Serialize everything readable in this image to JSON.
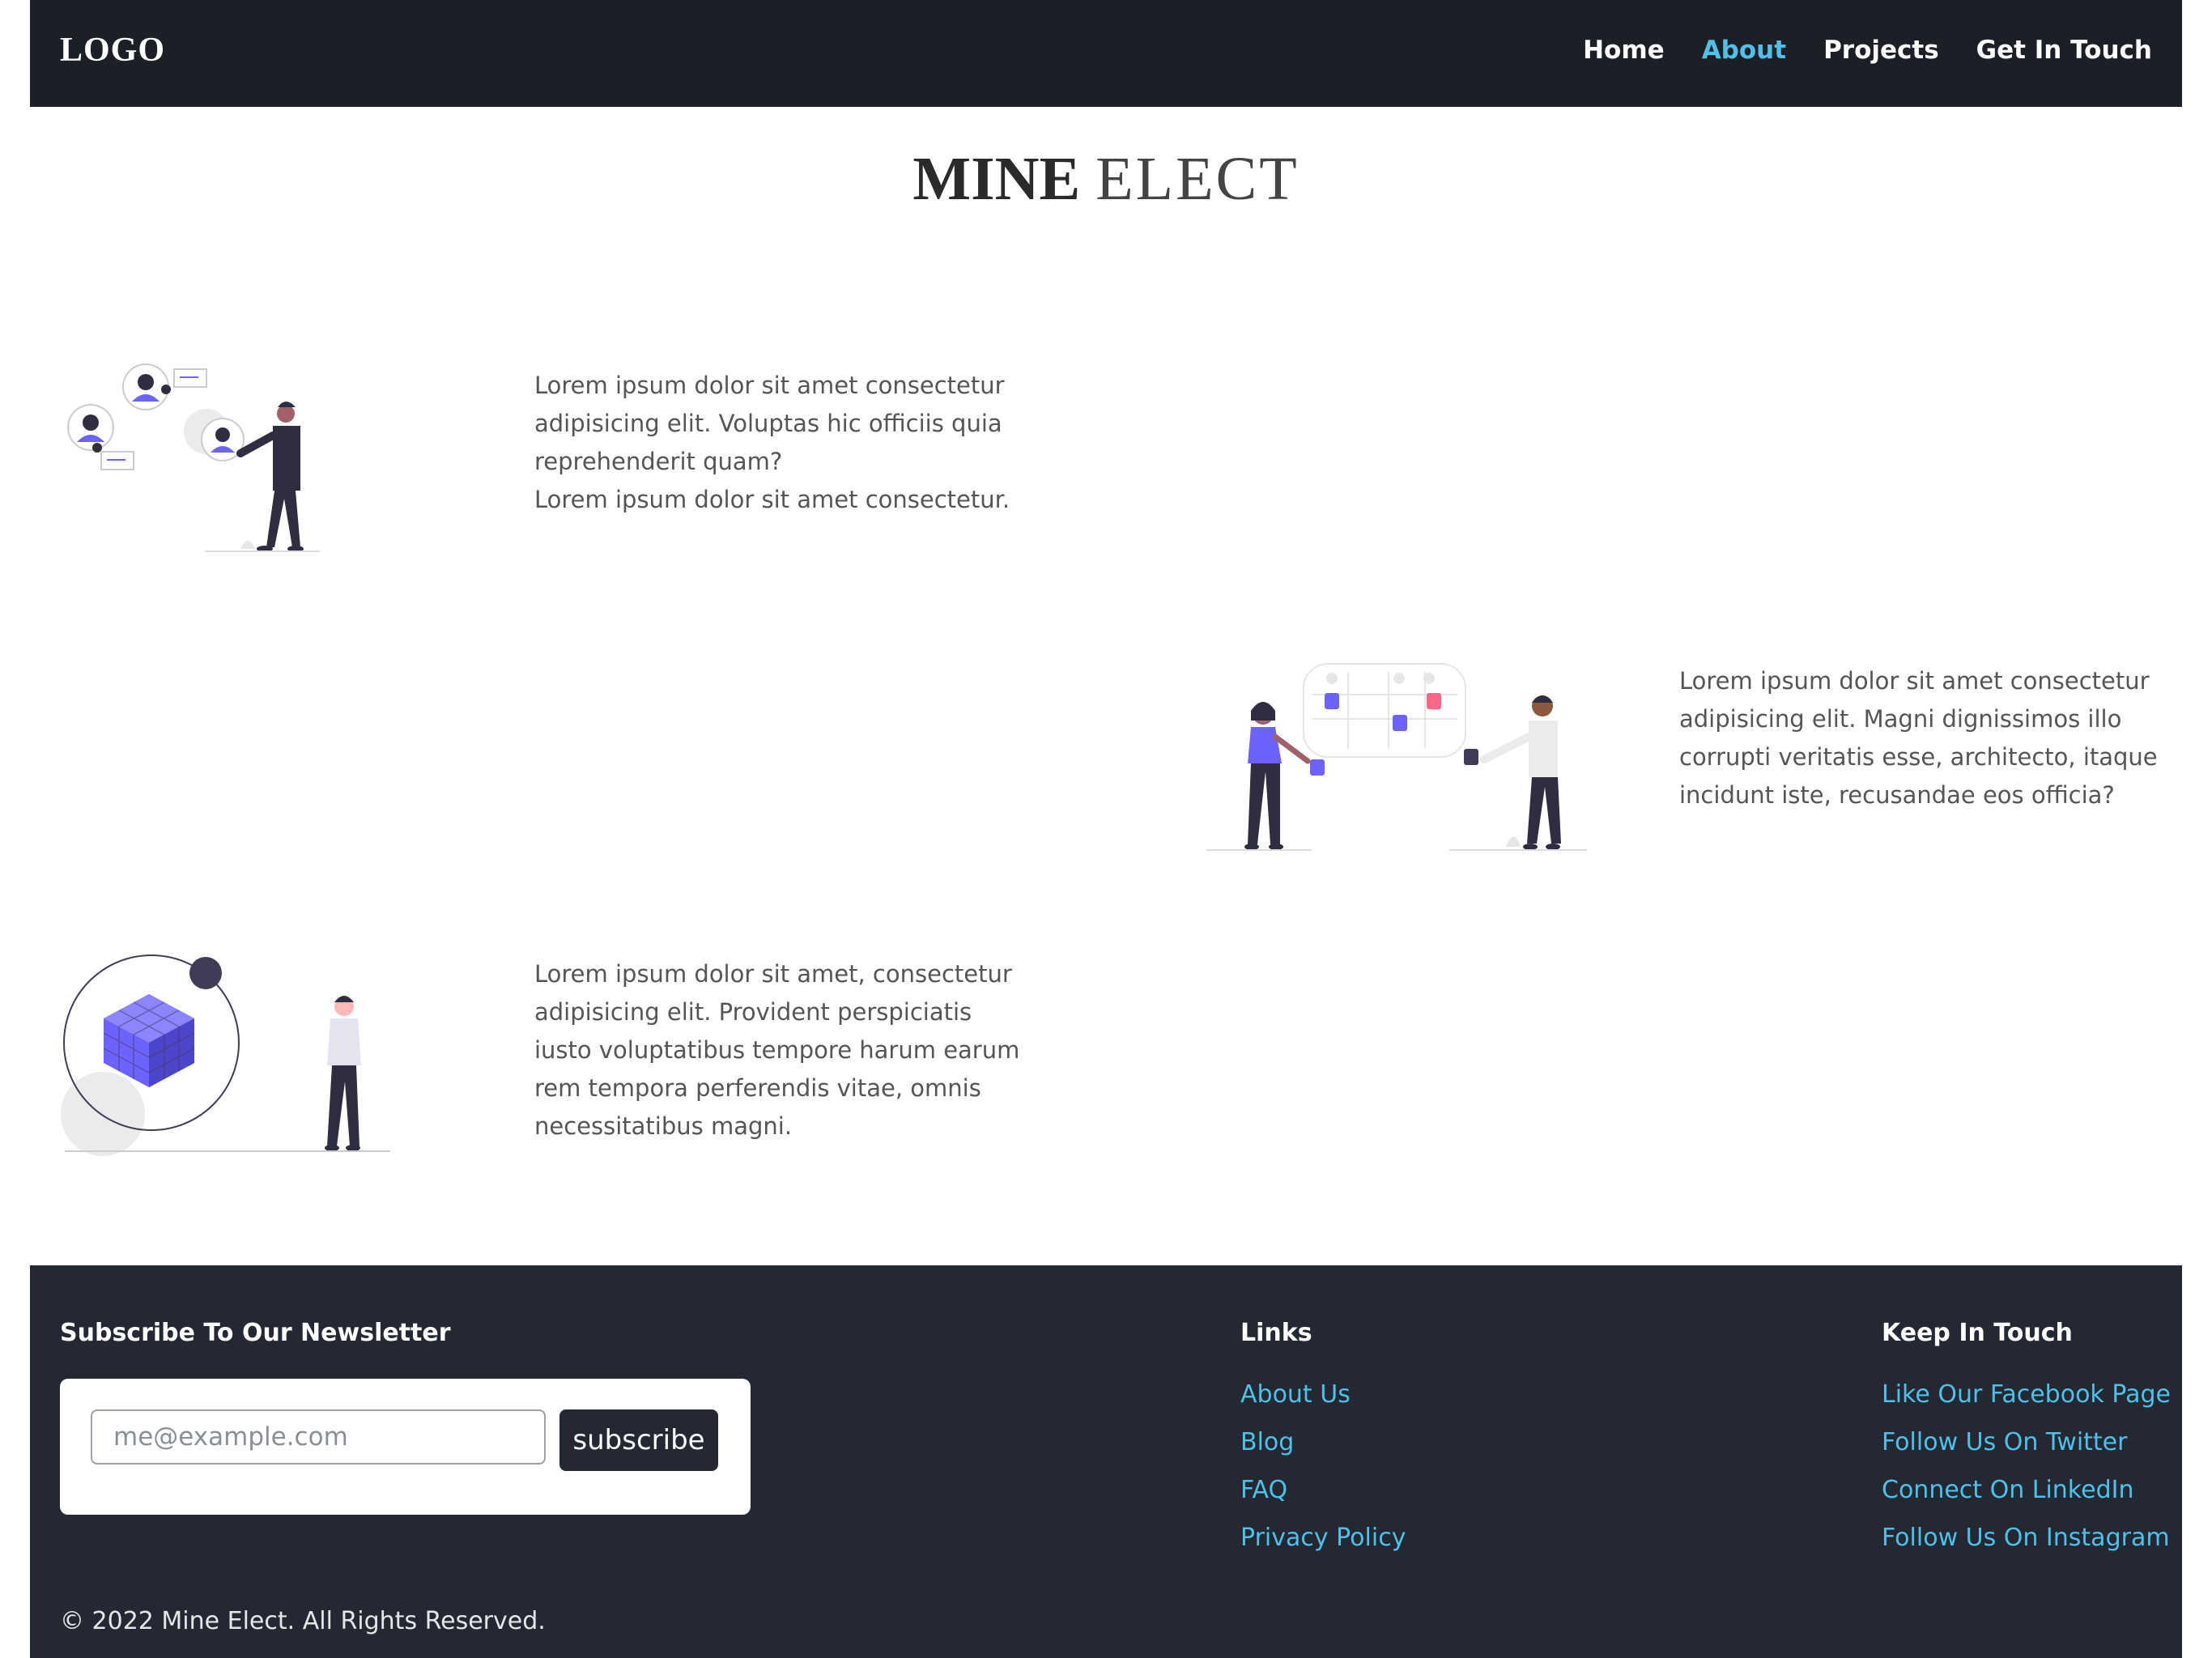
{
  "header": {
    "logo": "LOGO",
    "nav": [
      "Home",
      "About",
      "Projects",
      "Get In Touch"
    ]
  },
  "title": {
    "bold": "MINE",
    "regular": "ELECT"
  },
  "sections": [
    {
      "lines": [
        "Lorem ipsum dolor sit amet consectetur",
        "adipisicing elit. Voluptas hic officiis quia",
        "reprehenderit quam?",
        "Lorem ipsum dolor sit amet consectetur."
      ]
    },
    {
      "lines": [
        "Lorem ipsum dolor sit amet consectetur",
        "adipisicing elit. Magni dignissimos illo",
        "corrupti veritatis esse, architecto, itaque",
        "incidunt iste, recusandae eos officia?"
      ]
    },
    {
      "lines": [
        "Lorem ipsum dolor sit amet, consectetur",
        "adipisicing elit. Provident perspiciatis",
        "iusto voluptatibus tempore harum earum",
        "rem tempora perferendis vitae, omnis",
        "necessitatibus magni."
      ]
    }
  ],
  "footer": {
    "newsletter_title": "Subscribe To Our Newsletter",
    "email_placeholder": "me@example.com",
    "subscribe_label": "subscribe",
    "links_title": "Links",
    "links": [
      "About Us",
      "Blog",
      "FAQ",
      "Privacy Policy"
    ],
    "keep_title": "Keep In Touch",
    "social": [
      "Like Our Facebook Page",
      "Follow Us On Twitter",
      "Connect On LinkedIn",
      "Follow Us On Instagram"
    ],
    "copyright": "© 2022 Mine Elect. All Rights Reserved."
  },
  "colors": {
    "accent": "#4fc1e9",
    "header_bg": "#1d1f26",
    "footer_bg": "#232833",
    "illustration": "#6c63ff"
  }
}
